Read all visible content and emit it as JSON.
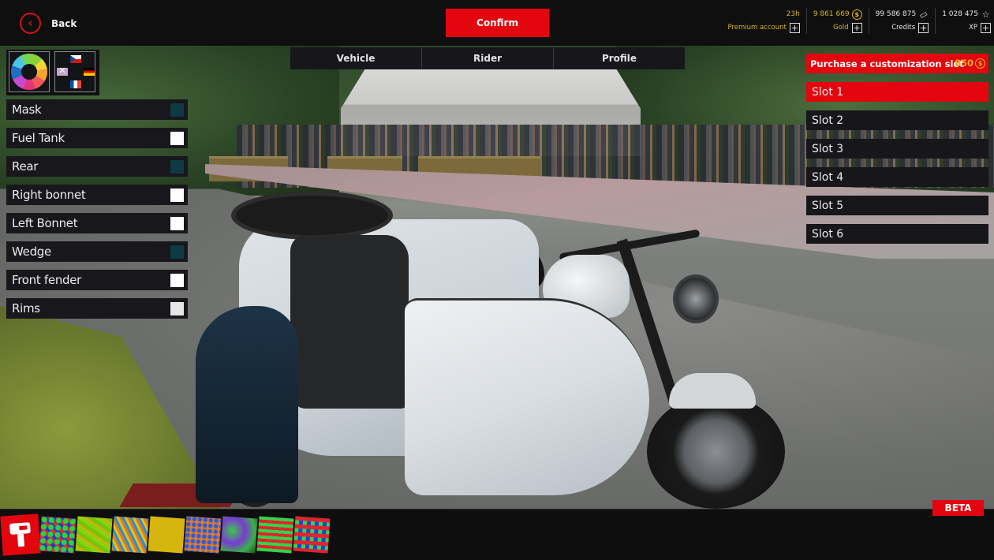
{
  "topbar": {
    "back_label": "Back",
    "back_icon": "chevron-left-circle-icon",
    "confirm_label": "Confirm",
    "currencies": [
      {
        "id": "premium",
        "value": "23h",
        "label": "Premium account",
        "icon": "",
        "color": "#d9b41c"
      },
      {
        "id": "gold",
        "value": "9 861 669",
        "label": "Gold",
        "icon": "coin-icon",
        "color": "#d9b41c"
      },
      {
        "id": "credits",
        "value": "99 586 875",
        "label": "Credits",
        "icon": "ticket-icon",
        "color": "#e6e6e6"
      },
      {
        "id": "xp",
        "value": "1 028 475",
        "label": "XP",
        "icon": "star-icon",
        "color": "#e6e6e6"
      }
    ],
    "plus_symbol": "+"
  },
  "tiles": [
    {
      "id": "color-wheel",
      "icon": "color-wheel-icon"
    },
    {
      "id": "flags",
      "icon": "flags-icon",
      "flags": [
        "Czech",
        "United Kingdom",
        "Germany",
        "France"
      ]
    }
  ],
  "tabs": [
    {
      "label": "Vehicle"
    },
    {
      "label": "Rider"
    },
    {
      "label": "Profile"
    }
  ],
  "parts": [
    {
      "label": "Mask",
      "color": "#0d3a44"
    },
    {
      "label": "Fuel Tank",
      "color": "#ffffff"
    },
    {
      "label": "Rear",
      "color": "#0d3a44"
    },
    {
      "label": "Right bonnet",
      "color": "#ffffff"
    },
    {
      "label": "Left Bonnet",
      "color": "#ffffff"
    },
    {
      "label": "Wedge",
      "color": "#0d3a44"
    },
    {
      "label": "Front fender",
      "color": "#ffffff"
    },
    {
      "label": "Rims",
      "color": "#e6e6e6"
    }
  ],
  "slots": {
    "purchase_label": "Purchase a customization slot",
    "purchase_price": "850",
    "purchase_currency_symbol": "$",
    "items": [
      {
        "label": "Slot 1",
        "active": true
      },
      {
        "label": "Slot 2",
        "active": false
      },
      {
        "label": "Slot 3",
        "active": false
      },
      {
        "label": "Slot 4",
        "active": false
      },
      {
        "label": "Slot 5",
        "active": false
      },
      {
        "label": "Slot 6",
        "active": false
      }
    ]
  },
  "bottom": {
    "beta_label": "BETA",
    "paint_icon": "paint-roller-icon",
    "patterns": [
      "pattern-1",
      "pattern-2",
      "pattern-3",
      "pattern-4",
      "pattern-5",
      "pattern-6",
      "pattern-7",
      "pattern-8",
      "pattern-9"
    ]
  },
  "colors": {
    "accent": "#e3060f",
    "gold": "#d9b41c",
    "panel": "#16161b"
  }
}
